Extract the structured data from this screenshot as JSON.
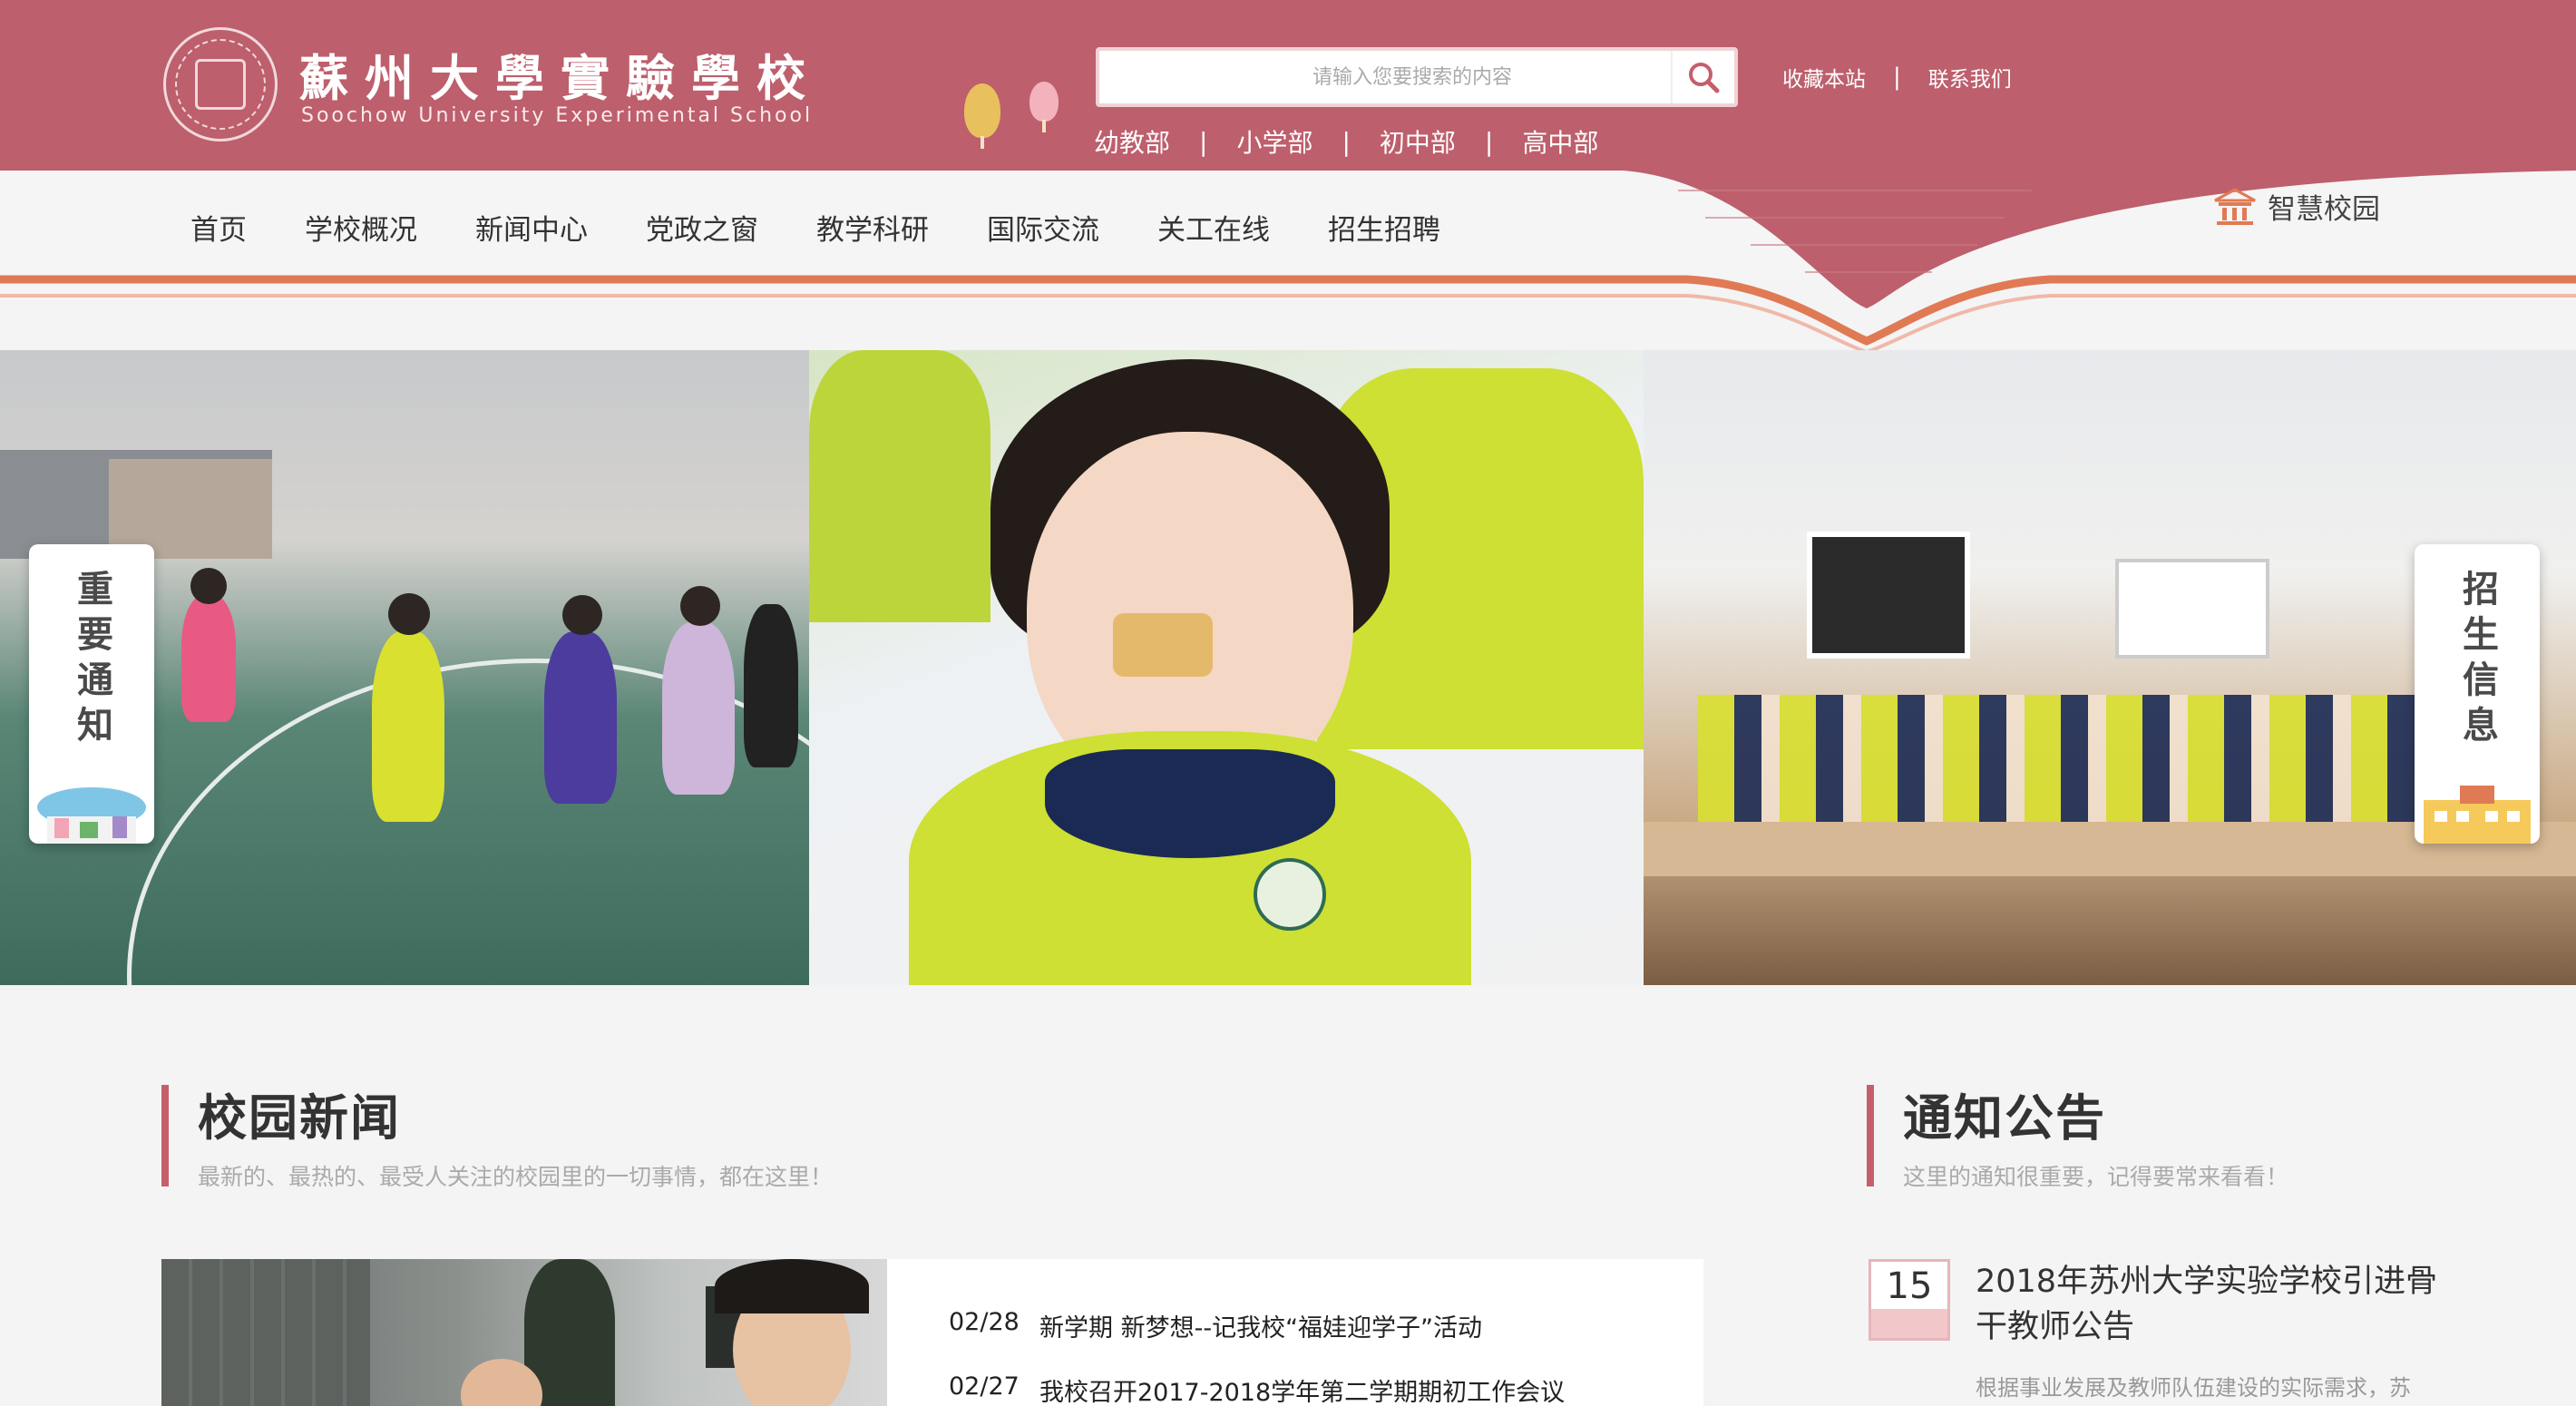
{
  "header": {
    "logo_cn": "蘇州大學實驗學校",
    "logo_en": "Soochow University Experimental School",
    "search_placeholder": "请输入您要搜索的内容",
    "top_links": [
      "收藏本站",
      "联系我们"
    ],
    "separator": "|",
    "departments": [
      "幼教部",
      "小学部",
      "初中部",
      "高中部"
    ]
  },
  "nav": {
    "items": [
      "首页",
      "学校概况",
      "新闻中心",
      "党政之窗",
      "教学科研",
      "国际交流",
      "关工在线",
      "招生招聘"
    ],
    "smart_campus": "智慧校园"
  },
  "banner": {
    "left_tab": "重要通知",
    "right_tab": "招生信息"
  },
  "news_section": {
    "title": "校园新闻",
    "subtitle": "最新的、最热的、最受人关注的校园里的一切事情，都在这里！",
    "items": [
      {
        "date": "02/28",
        "title": "新学期 新梦想--记我校“福娃迎学子”活动"
      },
      {
        "date": "02/27",
        "title": "我校召开2017-2018学年第二学期期初工作会议"
      }
    ]
  },
  "notice_section": {
    "title": "通知公告",
    "subtitle": "这里的通知很重要，记得要常来看看！",
    "items": [
      {
        "day": "15",
        "title": "2018年苏州大学实验学校引进骨干教师公告",
        "desc": "根据事业发展及教师队伍建设的实际需求，苏"
      }
    ]
  },
  "colors": {
    "brand": "#bd5f6c",
    "accent_orange": "#e07a55",
    "section_bar": "#c45f6b"
  }
}
